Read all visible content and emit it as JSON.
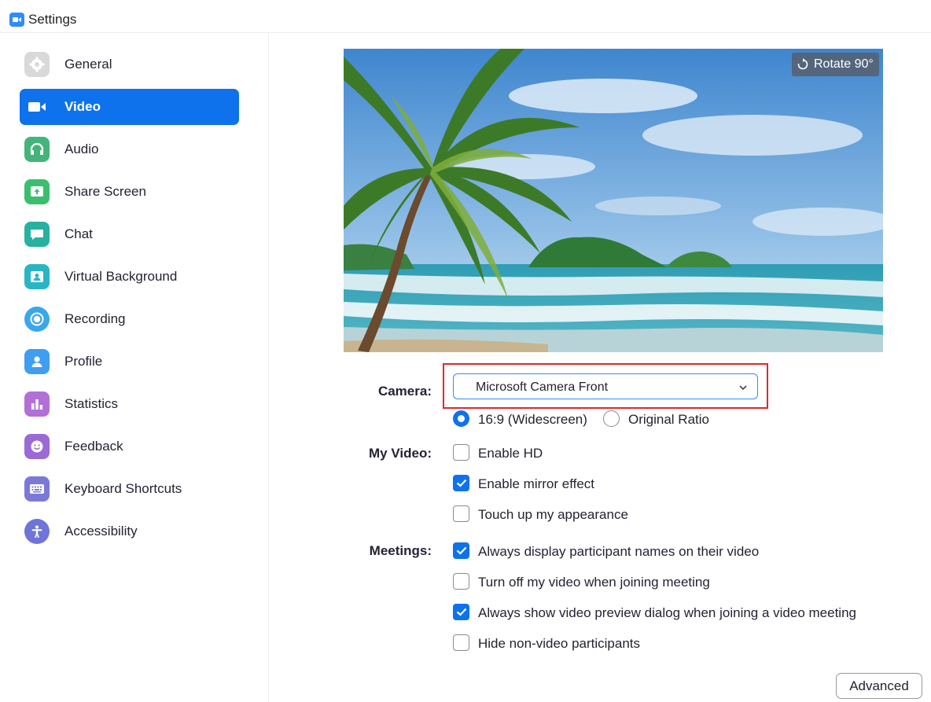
{
  "window": {
    "title": "Settings",
    "app_icon": "zoom-camera-icon"
  },
  "sidebar": {
    "items": [
      {
        "label": "General",
        "icon": "gear-icon",
        "color": "#d6d6d6",
        "active": false
      },
      {
        "label": "Video",
        "icon": "video-camera-icon",
        "color": "#0e72ed",
        "active": true
      },
      {
        "label": "Audio",
        "icon": "headphones-icon",
        "color": "#43b57b",
        "active": false
      },
      {
        "label": "Share Screen",
        "icon": "share-screen-icon",
        "color": "#3bbf6e",
        "active": false
      },
      {
        "label": "Chat",
        "icon": "chat-bubble-icon",
        "color": "#26b1a1",
        "active": false
      },
      {
        "label": "Virtual Background",
        "icon": "virtual-background-icon",
        "color": "#2ab5c5",
        "active": false
      },
      {
        "label": "Recording",
        "icon": "record-icon",
        "color": "#3aa6ee",
        "active": false
      },
      {
        "label": "Profile",
        "icon": "person-icon",
        "color": "#3f9ef0",
        "active": false
      },
      {
        "label": "Statistics",
        "icon": "bar-chart-icon",
        "color": "#b26fd6",
        "active": false
      },
      {
        "label": "Feedback",
        "icon": "smiley-icon",
        "color": "#9a6ad6",
        "active": false
      },
      {
        "label": "Keyboard Shortcuts",
        "icon": "keyboard-icon",
        "color": "#7b79d8",
        "active": false
      },
      {
        "label": "Accessibility",
        "icon": "accessibility-icon",
        "color": "#6e74d8",
        "active": false
      }
    ]
  },
  "video": {
    "preview_alt": "beach-palm-tree-preview",
    "rotate_label": "Rotate 90°",
    "camera_label": "Camera:",
    "camera_value": "Microsoft Camera Front",
    "ratio_options": [
      {
        "label": "16:9 (Widescreen)",
        "selected": true
      },
      {
        "label": "Original Ratio",
        "selected": false
      }
    ],
    "my_video_label": "My Video:",
    "my_video_options": [
      {
        "label": "Enable HD",
        "checked": false
      },
      {
        "label": "Enable mirror effect",
        "checked": true
      },
      {
        "label": "Touch up my appearance",
        "checked": false
      }
    ],
    "meetings_label": "Meetings:",
    "meetings_options": [
      {
        "label": "Always display participant names on their video",
        "checked": true
      },
      {
        "label": "Turn off my video when joining meeting",
        "checked": false
      },
      {
        "label": "Always show video preview dialog when joining a video meeting",
        "checked": true
      },
      {
        "label": "Hide non-video participants",
        "checked": false
      }
    ],
    "advanced_label": "Advanced"
  },
  "colors": {
    "accent": "#0e72ed",
    "highlight": "#e0272a"
  }
}
